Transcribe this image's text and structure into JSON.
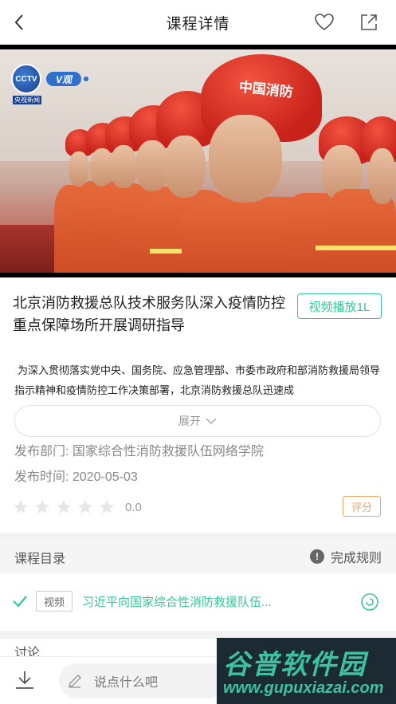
{
  "header": {
    "title": "课程详情"
  },
  "video": {
    "channel_badge": "V观",
    "channel_logo": "CCTV",
    "channel_sub": "央视新闻",
    "helmet_text": "中国消防"
  },
  "course": {
    "title": "北京消防救援总队技术服务队深入疫情防控重点保障场所开展调研指导",
    "play_badge": "视频播放1L",
    "description": "为深入贯彻落实党中央、国务院、应急管理部、市委市政府和部消防救援局领导指示精神和疫情防控工作决策部署，北京消防救援总队迅速成",
    "expand_label": "展开",
    "department": "发布部门: 国家综合性消防救援队伍网络学院",
    "publish_time": "发布时间: 2020-05-03",
    "rating": {
      "score": "0.0",
      "stars_filled": 0,
      "stars_total": 5,
      "rate_label": "评分"
    }
  },
  "catalog": {
    "label": "课程目录",
    "rules_label": "完成规则",
    "lessons": [
      {
        "tag": "视频",
        "name": "习近平向国家综合性消防救援队伍..."
      }
    ]
  },
  "discuss": {
    "label": "讨论"
  },
  "bottom": {
    "comment_placeholder": "说点什么吧"
  },
  "watermark": {
    "name": "谷普软件园",
    "url": "www.gupuxiazai.com"
  },
  "colors": {
    "accent": "#38c49a",
    "rate": "#f0a35a",
    "star": "#e6e6e6"
  }
}
